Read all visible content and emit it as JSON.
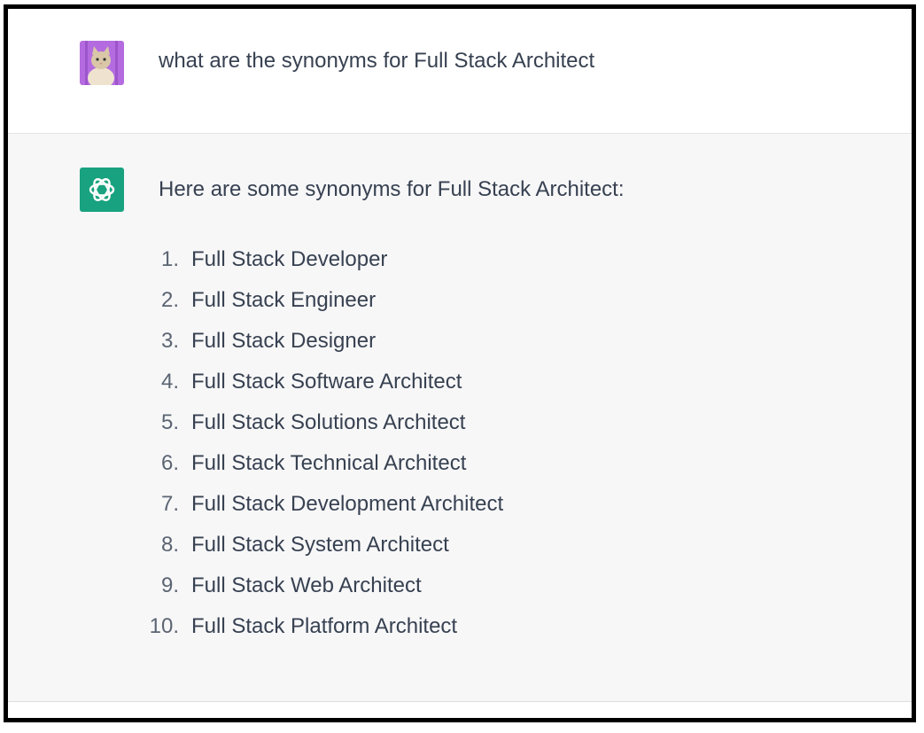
{
  "conversation": {
    "user_message": {
      "avatar_icon": "cat-avatar-icon",
      "avatar_color": "#b46be0",
      "text": "what are the synonyms for Full Stack Architect"
    },
    "assistant_message": {
      "avatar_icon": "openai-logo-icon",
      "avatar_color": "#19a27f",
      "intro": "Here are some synonyms for Full Stack Architect:",
      "items": [
        {
          "number": "1.",
          "label": "Full Stack Developer"
        },
        {
          "number": "2.",
          "label": "Full Stack Engineer"
        },
        {
          "number": "3.",
          "label": "Full Stack Designer"
        },
        {
          "number": "4.",
          "label": "Full Stack Software Architect"
        },
        {
          "number": "5.",
          "label": "Full Stack Solutions Architect"
        },
        {
          "number": "6.",
          "label": "Full Stack Technical Architect"
        },
        {
          "number": "7.",
          "label": "Full Stack Development Architect"
        },
        {
          "number": "8.",
          "label": "Full Stack System Architect"
        },
        {
          "number": "9.",
          "label": "Full Stack Web Architect"
        },
        {
          "number": "10.",
          "label": "Full Stack Platform Architect"
        }
      ]
    }
  }
}
